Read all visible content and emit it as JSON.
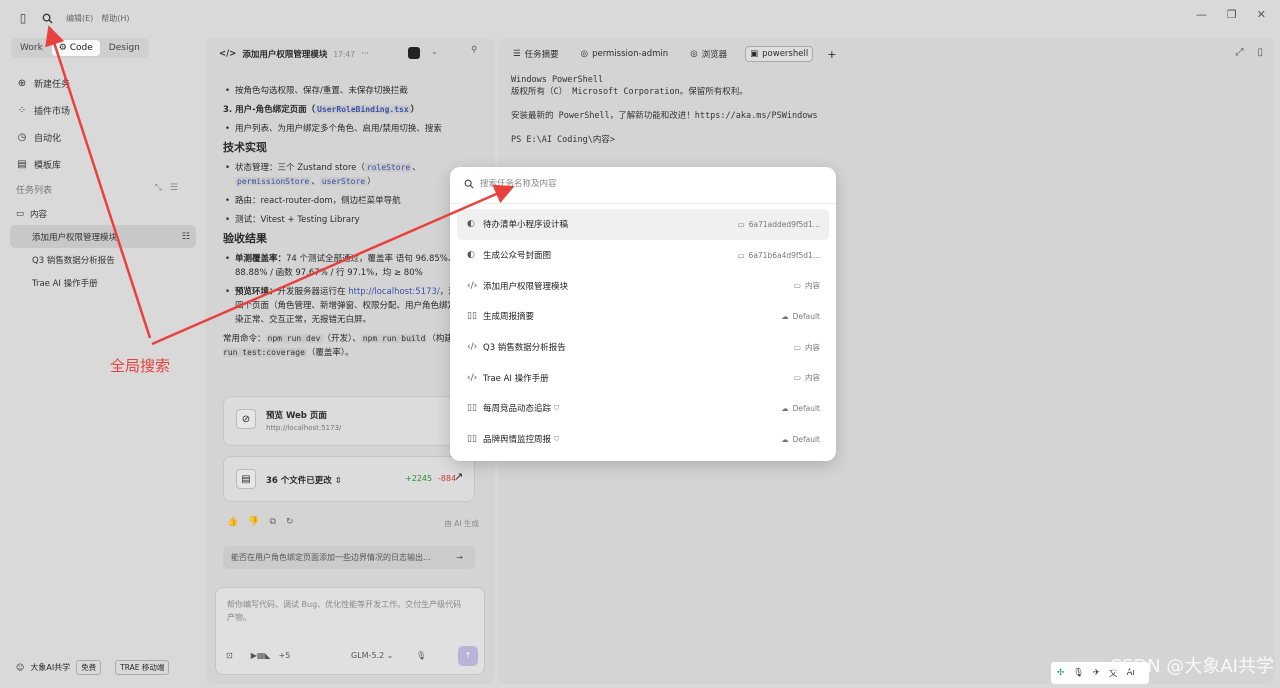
{
  "menu": {
    "edit": "编辑(E)",
    "help": "帮助(H)"
  },
  "modes": {
    "work": "Work",
    "code": "Code",
    "design": "Design"
  },
  "nav": {
    "new_task": "新建任务",
    "plugin_market": "插件市场",
    "automation": "自动化",
    "templates": "模板库"
  },
  "tasks": {
    "header": "任务列表",
    "folder": "内容",
    "items": [
      "添加用户权限管理模块",
      "Q3 销售数据分析报告",
      "Trae AI 操作手册"
    ]
  },
  "user": {
    "name": "大象AI共学",
    "plan": "免费",
    "mobile": "TRAE 移动端"
  },
  "chat": {
    "title": "添加用户权限管理模块",
    "time": "17:47",
    "line1": "按角色勾选权限、保存/重置、未保存切换拦截",
    "sec3_prefix": "3. 用户-角色绑定页面（",
    "sec3_code": "UserRoleBinding.tsx",
    "sec3_suffix": "）",
    "line3": "用户列表、为用户绑定多个角色、启用/禁用切换、搜索",
    "tech_heading": "技术实现",
    "state_prefix": "状态管理：三个 Zustand store（",
    "store1": "roleStore",
    "sep1": "、",
    "store2": "permissionStore",
    "sep2": "、",
    "store3": "userStore",
    "state_suffix": "）",
    "routing": "路由：react-router-dom，侧边栏菜单导航",
    "testing": "测试：Vitest + Testing Library",
    "accept_heading": "验收结果",
    "unit_label": "单测覆盖率：",
    "unit_text": "74 个测试全部通过，覆盖率 语句 96.85%、分支 88.88% / 函数 97.67% / 行 97.1%，均 ≥ 80%",
    "preview_label": "预览环境：",
    "preview_prefix": "开发服务器运行在 ",
    "preview_link": "http://localhost:5173/",
    "preview_text": "，浏览器验证四个页面（角色管理、新增弹窗、权限分配、用户角色绑定）全部渲染正常、交互正常，无报错无白屏。",
    "cmd_prefix": "常用命令：",
    "cmd1": "npm run dev",
    "cmd1_note": "（开发）、",
    "cmd2": "npm run build",
    "cmd2_note": "（构建）、",
    "cmd3": "npm run test:coverage",
    "cmd3_note": "（覆盖率）。",
    "card_preview_title": "预览 Web 页面",
    "card_preview_url": "http://localhost:5173/",
    "files_changed": "36 个文件已更改",
    "additions": "+2245",
    "deletions": "-884",
    "ai_generated": "由 AI 生成",
    "suggestion": "能否在用户角色绑定页面添加一些边界情况的日志输出…",
    "input_placeholder": "帮你编写代码、调试 Bug、优化性能等开发工作。交付生产级代码产物。",
    "plugin_count": "+5",
    "model": "GLM-5.2"
  },
  "terminal": {
    "tabs": [
      "任务摘要",
      "permission-admin",
      "浏览器",
      "powershell"
    ],
    "lines": [
      "Windows PowerShell",
      "版权所有（C） Microsoft Corporation。保留所有权利。",
      "",
      "安装最新的 PowerShell，了解新功能和改进！https://aka.ms/PSWindows",
      "",
      "PS E:\\AI Coding\\内容>"
    ]
  },
  "search": {
    "placeholder": "搜索任务名称及内容",
    "results": [
      {
        "title": "待办清单小程序设计稿",
        "location": "6a71added9f5d1...",
        "icon": "palette-icon",
        "loc_icon": "folder-icon"
      },
      {
        "title": "生成公众号封面图",
        "location": "6a71b6a4d9f5d1...",
        "icon": "palette-icon",
        "loc_icon": "folder-icon"
      },
      {
        "title": "添加用户权限管理模块",
        "location": "内容",
        "icon": "code-icon",
        "loc_icon": "folder-icon"
      },
      {
        "title": "生成周报摘要",
        "location": "Default",
        "icon": "book-icon",
        "loc_icon": "cloud-icon"
      },
      {
        "title": "Q3 销售数据分析报告",
        "location": "内容",
        "icon": "code-icon",
        "loc_icon": "folder-icon"
      },
      {
        "title": "Trae AI 操作手册",
        "location": "内容",
        "icon": "code-icon",
        "loc_icon": "folder-icon"
      },
      {
        "title": "每周竞品动态追踪",
        "location": "Default",
        "icon": "book-icon",
        "loc_icon": "cloud-icon"
      },
      {
        "title": "品牌舆情监控周报",
        "location": "Default",
        "icon": "book-icon",
        "loc_icon": "cloud-icon"
      }
    ]
  },
  "annotation": {
    "label": "全局搜索",
    "color": "#e8413e"
  },
  "watermark": "CSDN @大象AI共学",
  "colors": {
    "accent": "#3a50a8",
    "additions": "#2a8a3a",
    "deletions": "#c43c3c",
    "send_button": "#b9b3d8"
  }
}
